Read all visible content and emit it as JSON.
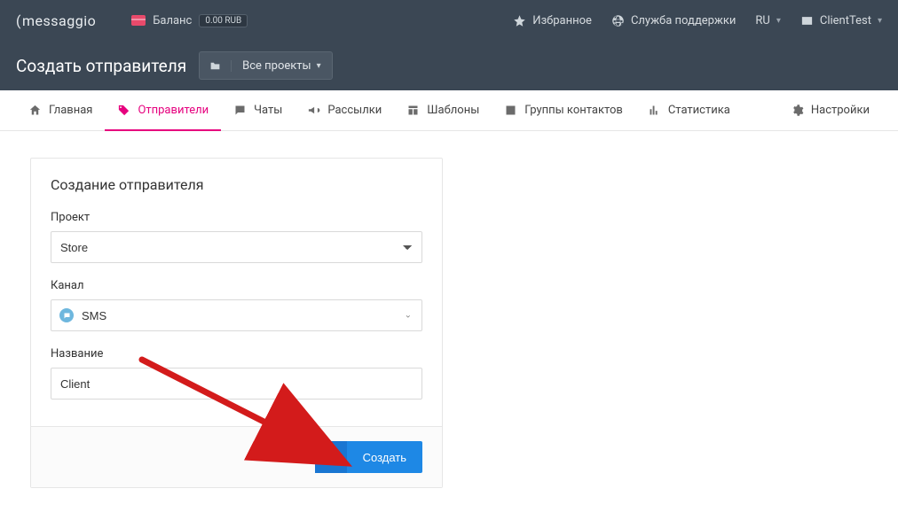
{
  "brand": "messaggio",
  "header": {
    "balance_label": "Баланс",
    "balance_value": "0.00 RUB",
    "favorites": "Избранное",
    "support": "Служба поддержки",
    "lang": "RU",
    "user": "ClientTest"
  },
  "subheader": {
    "page_title": "Создать отправителя",
    "project_selector": "Все проекты"
  },
  "nav": {
    "home": "Главная",
    "senders": "Отправители",
    "chats": "Чаты",
    "campaigns": "Рассылки",
    "templates": "Шаблоны",
    "groups": "Группы контактов",
    "stats": "Статистика",
    "settings": "Настройки"
  },
  "form": {
    "card_title": "Создание отправителя",
    "project_label": "Проект",
    "project_value": "Store",
    "channel_label": "Канал",
    "channel_value": "SMS",
    "name_label": "Название",
    "name_value": "Client",
    "submit": "Создать"
  }
}
